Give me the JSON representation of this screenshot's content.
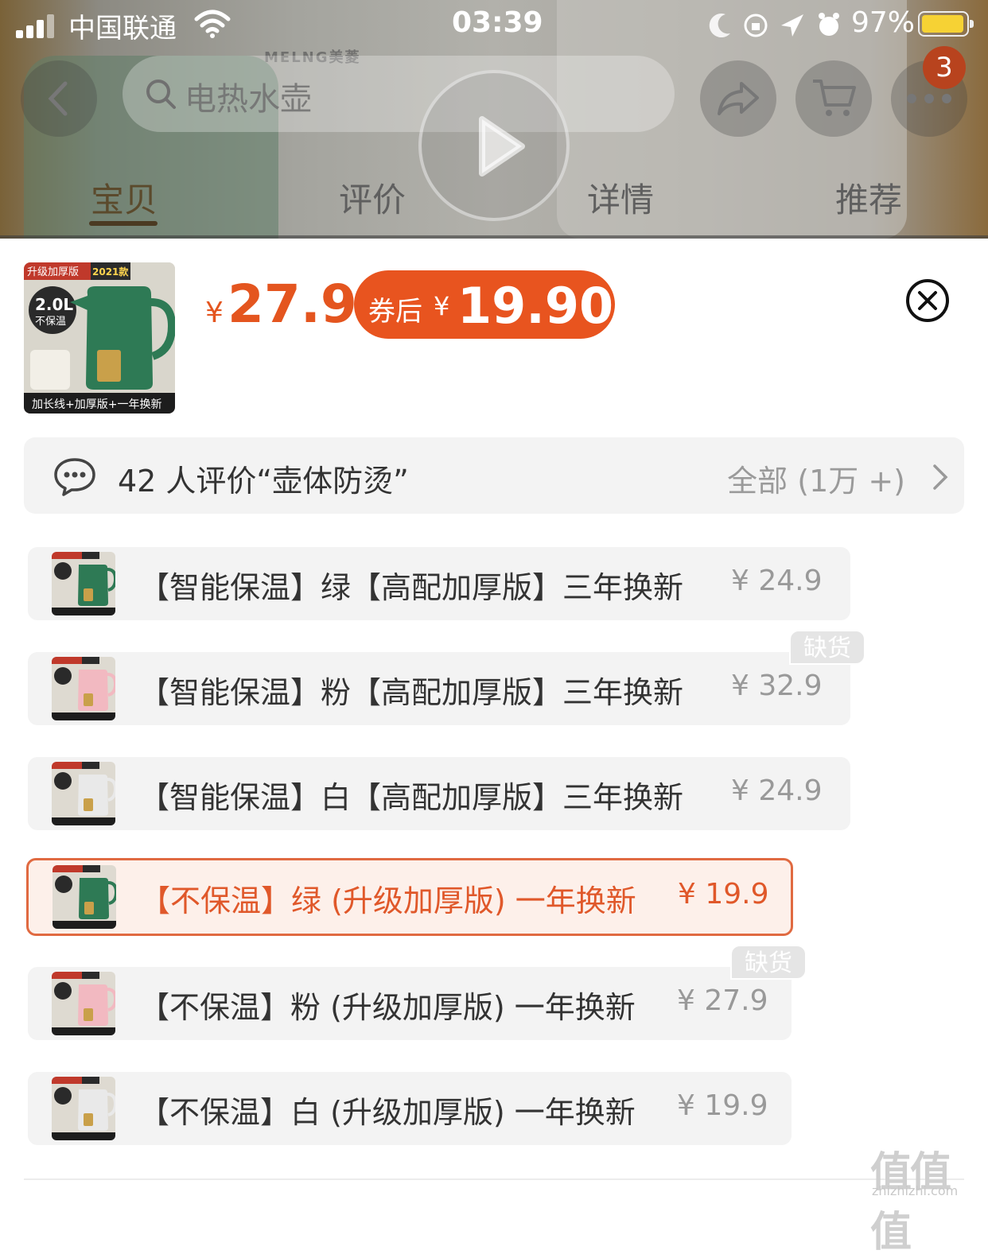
{
  "status_bar": {
    "carrier": "中国联通",
    "time": "03:39",
    "battery_percent": "97%",
    "battery_level": 0.97
  },
  "header": {
    "brand_text": "MELNG美菱",
    "search_placeholder": "电热水壶",
    "cart_badge": "3",
    "tabs": [
      "宝贝",
      "评价",
      "详情",
      "推荐"
    ],
    "active_tab": "宝贝"
  },
  "sheet": {
    "thumbnail": {
      "top_label": "升级加厚版",
      "year_label": "2021款",
      "capacity": "2.0L",
      "feature": "不保温",
      "bottom_label": "加长线+加厚版+一年换新"
    },
    "price_symbol": "¥",
    "price": "27.9",
    "coupon": {
      "label": "券后",
      "symbol": "¥",
      "price": "19.90"
    },
    "review": {
      "text": "42 人评价“壶体防烫”",
      "all_label": "全部 (1万 +)"
    },
    "out_of_stock_label": "缺货",
    "skus": [
      {
        "name": "【智能保温】绿【高配加厚版】三年换新",
        "price": "¥ 24.9",
        "color": "#2e7a55",
        "out_of_stock": false,
        "selected": false
      },
      {
        "name": "【智能保温】粉【高配加厚版】三年换新",
        "price": "¥ 32.9",
        "color": "#f2b9c1",
        "out_of_stock": true,
        "selected": false
      },
      {
        "name": "【智能保温】白【高配加厚版】三年换新",
        "price": "¥ 24.9",
        "color": "#e9e9e9",
        "out_of_stock": false,
        "selected": false
      },
      {
        "name": "【不保温】绿 (升级加厚版) 一年换新",
        "price": "¥ 19.9",
        "color": "#2e7a55",
        "out_of_stock": false,
        "selected": true
      },
      {
        "name": "【不保温】粉 (升级加厚版) 一年换新",
        "price": "¥ 27.9",
        "color": "#f2b9c1",
        "out_of_stock": true,
        "selected": false
      },
      {
        "name": "【不保温】白 (升级加厚版) 一年换新",
        "price": "¥ 19.9",
        "color": "#e9e9e9",
        "out_of_stock": false,
        "selected": false
      }
    ]
  },
  "watermark": {
    "text": "值值值",
    "domain": "zhizhizhi.com"
  },
  "colors": {
    "accent": "#e8541f",
    "selected_border": "#e06a41",
    "selected_bg": "#fdf0ea",
    "row_bg": "#f3f3f3"
  }
}
